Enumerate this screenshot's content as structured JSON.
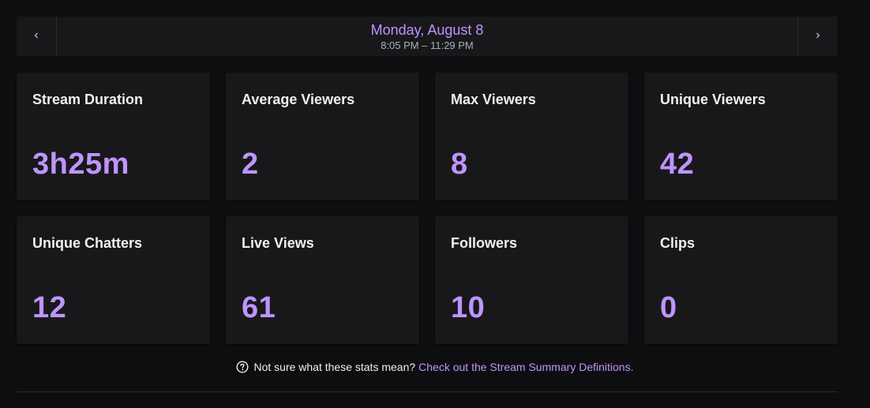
{
  "date_nav": {
    "title": "Monday, August 8",
    "time_range": "8:05 PM – 11:29 PM",
    "prev_icon": "chevron-left-icon",
    "next_icon": "chevron-right-icon"
  },
  "stats": [
    {
      "label": "Stream Duration",
      "value": "3h25m"
    },
    {
      "label": "Average Viewers",
      "value": "2"
    },
    {
      "label": "Max Viewers",
      "value": "8"
    },
    {
      "label": "Unique Viewers",
      "value": "42"
    },
    {
      "label": "Unique Chatters",
      "value": "12"
    },
    {
      "label": "Live Views",
      "value": "61"
    },
    {
      "label": "Followers",
      "value": "10"
    },
    {
      "label": "Clips",
      "value": "0"
    }
  ],
  "help": {
    "icon": "question-circle-icon",
    "text": "Not sure what these stats mean?",
    "link_text": "Check out the Stream Summary Definitions."
  },
  "colors": {
    "background": "#0e0e10",
    "card": "#18181b",
    "accent": "#bf94ff",
    "text": "#efeff1",
    "muted": "#adadb8"
  }
}
